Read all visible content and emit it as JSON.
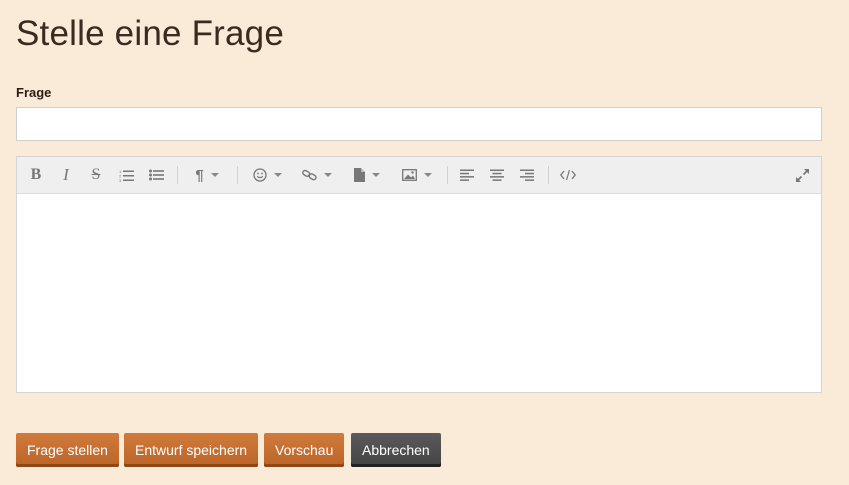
{
  "page": {
    "title": "Stelle eine Frage"
  },
  "form": {
    "question_label": "Frage",
    "question_value": "",
    "question_placeholder": ""
  },
  "editor": {
    "content": "",
    "toolbar_icons": [
      "bold-icon",
      "italic-icon",
      "strikethrough-icon",
      "ordered-list-icon",
      "unordered-list-icon",
      "paragraph-icon",
      "emoji-icon",
      "link-icon",
      "file-icon",
      "image-icon",
      "align-left-icon",
      "align-center-icon",
      "align-right-icon",
      "code-view-icon",
      "fullscreen-icon"
    ]
  },
  "buttons": {
    "submit": "Frage stellen",
    "save_draft": "Entwurf speichern",
    "preview": "Vorschau",
    "cancel": "Abbrechen"
  },
  "colors": {
    "background": "#f9ebd8",
    "primary_button": "#c66f33",
    "cancel_button": "#4e4e4e"
  }
}
